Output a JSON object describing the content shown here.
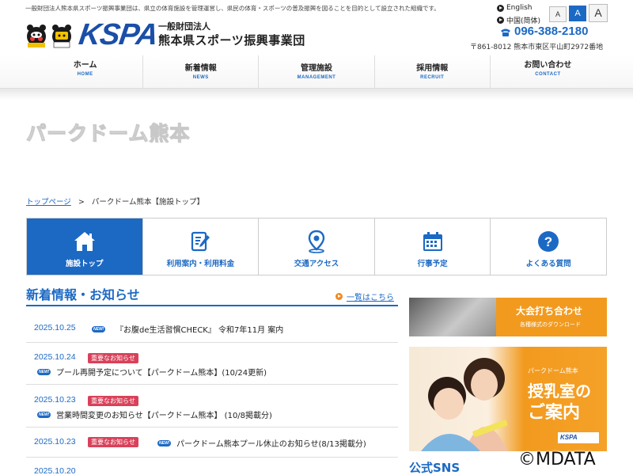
{
  "header": {
    "tagline": "一般財団法人熊本県スポーツ振興事業団は、県立の体育施設を管理運営し、県民の体育・スポーツの普及振興を図ることを目的として設立された組織です。",
    "logo_text": "KSPA",
    "org_type": "一般財団法人",
    "org_name": "熊本県スポーツ振興事業団",
    "languages": [
      "English",
      "中国(简体)"
    ],
    "font_sizes": [
      {
        "label": "A",
        "active": false
      },
      {
        "label": "A",
        "active": true
      },
      {
        "label": "A",
        "active": false
      }
    ],
    "phone": "096-388-2180",
    "address": "〒861-8012 熊本市東区平山町2972番地"
  },
  "nav": [
    {
      "label": "ホーム",
      "en": "HOME"
    },
    {
      "label": "新着情報",
      "en": "NEWS"
    },
    {
      "label": "管理施設",
      "en": "MANAGEMENT"
    },
    {
      "label": "採用情報",
      "en": "RECRUIT"
    },
    {
      "label": "お問い合わせ",
      "en": "CONTACT"
    }
  ],
  "hero": {
    "title": "パークドーム熊本"
  },
  "breadcrumb": {
    "home": "トップページ",
    "separator": ">",
    "current": "パークドーム熊本【施設トップ】"
  },
  "facility_tabs": [
    {
      "label": "施設トップ",
      "icon": "home-icon",
      "active": true
    },
    {
      "label": "利用案内・利用料金",
      "icon": "edit-icon",
      "active": false
    },
    {
      "label": "交通アクセス",
      "icon": "map-pin-icon",
      "active": false
    },
    {
      "label": "行事予定",
      "icon": "calendar-icon",
      "active": false
    },
    {
      "label": "よくある質問",
      "icon": "question-icon",
      "active": false
    }
  ],
  "news": {
    "heading": "新着情報・お知らせ",
    "more_label": "一覧はこちら",
    "new_tag": "NEW!",
    "items": [
      {
        "date": "2025.10.25",
        "badge": "",
        "text": "『お腹de生活習慣CHECK』 令和7年11月 案内"
      },
      {
        "date": "2025.10.24",
        "badge": "重要なお知らせ",
        "text": "プール再開予定について【パークドーム熊本】(10/24更新)"
      },
      {
        "date": "2025.10.23",
        "badge": "重要なお知らせ",
        "text": "営業時間変更のお知らせ【パークドーム熊本】 (10/8掲載分)"
      },
      {
        "date": "2025.10.23",
        "badge": "重要なお知らせ",
        "text": "パークドーム熊本プール休止のお知らせ(8/13掲載分)"
      },
      {
        "date": "2025.10.20",
        "badge": "",
        "text": ""
      }
    ]
  },
  "banners": {
    "tournament": {
      "title": "大会打ち合わせ",
      "sub": "各種様式のダウンロード"
    },
    "nursing": {
      "brand": "パークドーム熊本",
      "line1": "授乳室の",
      "line2": "ご案内",
      "logo": "KSPA"
    }
  },
  "sns_heading": "公式SNS",
  "watermark": "©MDATA",
  "colors": {
    "brand_blue": "#1c69c4",
    "badge_red": "#d9415a",
    "accent_orange": "#f29a1e"
  }
}
